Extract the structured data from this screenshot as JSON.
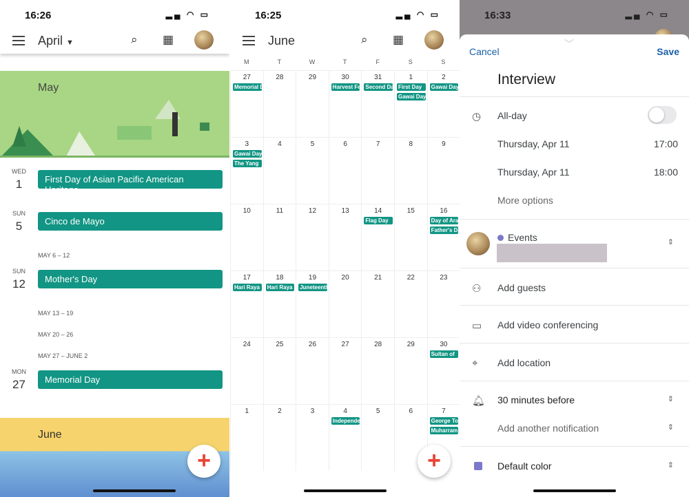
{
  "left": {
    "time": "16:26",
    "month": "April",
    "banner_may": "May",
    "banner_june": "June",
    "entries": [
      {
        "dow": "WED",
        "day": "1",
        "event": "First Day of Asian Pacific American Heritage"
      },
      {
        "dow": "SUN",
        "day": "5",
        "event": "Cinco de Mayo"
      },
      {
        "dow": "SUN",
        "day": "12",
        "event": "Mother's Day"
      },
      {
        "dow": "MON",
        "day": "27",
        "event": "Memorial Day"
      }
    ],
    "weeks": [
      "MAY 6 – 12",
      "MAY 13 – 19",
      "MAY 20 – 26",
      "MAY 27 – JUNE 2"
    ]
  },
  "middle": {
    "time": "16:25",
    "month": "June",
    "weekdays": [
      "M",
      "T",
      "W",
      "T",
      "F",
      "S",
      "S"
    ],
    "weeks": [
      [
        {
          "d": "27",
          "e": [
            "Memorial Day"
          ]
        },
        {
          "d": "28",
          "e": []
        },
        {
          "d": "29",
          "e": []
        },
        {
          "d": "30",
          "e": [
            "Harvest Festival"
          ]
        },
        {
          "d": "31",
          "e": [
            "Second Day"
          ]
        },
        {
          "d": "1",
          "e": [
            "First Day",
            "Gawai Day"
          ]
        },
        {
          "d": "2",
          "e": [
            "Gawai Day"
          ]
        }
      ],
      [
        {
          "d": "3",
          "e": [
            "Gawai Day",
            "The Yang"
          ]
        },
        {
          "d": "4",
          "e": []
        },
        {
          "d": "5",
          "e": []
        },
        {
          "d": "6",
          "e": []
        },
        {
          "d": "7",
          "e": []
        },
        {
          "d": "8",
          "e": []
        },
        {
          "d": "9",
          "e": []
        }
      ],
      [
        {
          "d": "10",
          "e": []
        },
        {
          "d": "11",
          "e": []
        },
        {
          "d": "12",
          "e": []
        },
        {
          "d": "13",
          "e": []
        },
        {
          "d": "14",
          "e": [
            "Flag Day"
          ]
        },
        {
          "d": "15",
          "e": []
        },
        {
          "d": "16",
          "e": [
            "Day of Arafat",
            "Father's Day"
          ]
        }
      ],
      [
        {
          "d": "17",
          "e": [
            "Hari Raya"
          ]
        },
        {
          "d": "18",
          "e": [
            "Hari Raya"
          ]
        },
        {
          "d": "19",
          "e": [
            "Juneteenth"
          ]
        },
        {
          "d": "20",
          "e": []
        },
        {
          "d": "21",
          "e": []
        },
        {
          "d": "22",
          "e": []
        },
        {
          "d": "23",
          "e": []
        }
      ],
      [
        {
          "d": "24",
          "e": []
        },
        {
          "d": "25",
          "e": []
        },
        {
          "d": "26",
          "e": []
        },
        {
          "d": "27",
          "e": []
        },
        {
          "d": "28",
          "e": []
        },
        {
          "d": "29",
          "e": []
        },
        {
          "d": "30",
          "e": [
            "Sultan of"
          ]
        }
      ],
      [
        {
          "d": "1",
          "e": []
        },
        {
          "d": "2",
          "e": []
        },
        {
          "d": "3",
          "e": []
        },
        {
          "d": "4",
          "e": [
            "Independence Day"
          ]
        },
        {
          "d": "5",
          "e": []
        },
        {
          "d": "6",
          "e": []
        },
        {
          "d": "7",
          "e": [
            "George Town",
            "Muharram"
          ]
        }
      ]
    ]
  },
  "right": {
    "time": "16:33",
    "cancel": "Cancel",
    "save": "Save",
    "title": "Interview",
    "allday": "All-day",
    "allday_on": false,
    "start_date": "Thursday, Apr 11",
    "start_time": "17:00",
    "end_date": "Thursday, Apr 11",
    "end_time": "18:00",
    "more": "More options",
    "calendar": "Events",
    "calendar_color": "#7b79c9",
    "guests": "Add guests",
    "video": "Add video conferencing",
    "location": "Add location",
    "notification": "30 minutes before",
    "add_notification": "Add another notification",
    "color": "Default color"
  },
  "colors": {
    "event": "#129584",
    "accent": "#1a73e8"
  }
}
